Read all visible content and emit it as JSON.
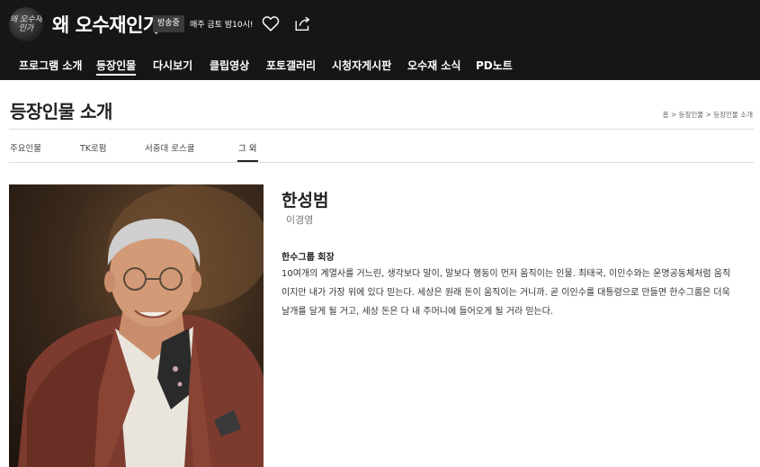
{
  "header": {
    "logo_text": "왜 오수재 인가",
    "title": "왜 오수재인가",
    "onair_badge": "방송중",
    "schedule": "매주 금토 밤10시!",
    "icons": [
      "heart-icon",
      "share-icon"
    ]
  },
  "nav": {
    "items": [
      {
        "label": "프로그램 소개"
      },
      {
        "label": "등장인물"
      },
      {
        "label": "다시보기"
      },
      {
        "label": "클립영상"
      },
      {
        "label": "포토갤러리"
      },
      {
        "label": "시청자게시판"
      },
      {
        "label": "오수재 소식"
      },
      {
        "label": "PD노트"
      }
    ],
    "active_index": 1
  },
  "page": {
    "title": "등장인물 소개",
    "breadcrumb": "홈 > 등장인물 > 등장인물 소개"
  },
  "subtabs": {
    "items": [
      {
        "label": "주요인물"
      },
      {
        "label": "TK로펌"
      },
      {
        "label": "서중대 로스쿨"
      },
      {
        "label": "그 외"
      }
    ],
    "active_index": 3
  },
  "profile": {
    "name": "한성범",
    "actor": "이경영",
    "role": "한수그룹 회장",
    "description": "10여개의 계열사를 거느린, 생각보다 말이, 말보다 행동이 먼저 움직이는 인물. 최태국, 이인수와는 운명공동체처럼 움직이지만 내가 가장 위에 있다 믿는다. 세상은 원래 돈이 움직이는 거니까. 곧 이인수를 대통령으로 만들면 한수그룹은 더욱 날개를 달게 될 거고, 세상 돈은 다 내 주머니에 들어오게 될 거라 믿는다."
  }
}
